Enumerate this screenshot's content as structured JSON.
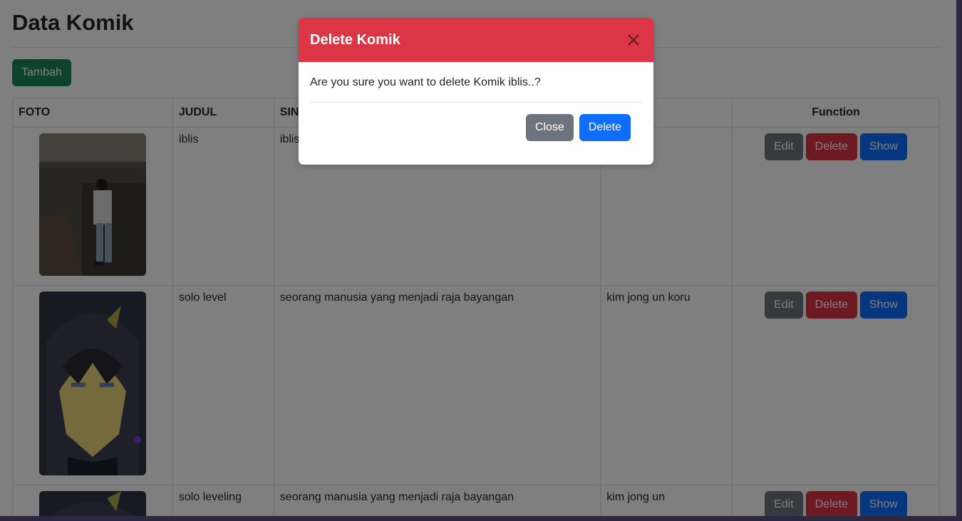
{
  "page": {
    "title": "Data Komik",
    "add_button": "Tambah"
  },
  "table": {
    "headers": {
      "foto": "FOTO",
      "judul": "JUDUL",
      "sinopsis": "SIN",
      "penulis": "",
      "function": "Function"
    },
    "rows": [
      {
        "judul": "iblis",
        "sinopsis": "iblis",
        "penulis": "",
        "foto_icon": "photo-person-wall"
      },
      {
        "judul": "solo level",
        "sinopsis": "seorang manusia yang menjadi raja bayangan",
        "penulis": "kim jong un koru",
        "foto_icon": "photo-anime-character"
      },
      {
        "judul": "solo leveling",
        "sinopsis": "seorang manusia yang menjadi raja bayangan",
        "penulis": "kim jong un",
        "foto_icon": "photo-anime-character"
      }
    ],
    "actions": {
      "edit": "Edit",
      "delete": "Delete",
      "show": "Show"
    }
  },
  "modal": {
    "title": "Delete Komik",
    "message": "Are you sure you want to delete Komik iblis..?",
    "close_button": "Close",
    "delete_button": "Delete"
  },
  "colors": {
    "success": "#198754",
    "secondary": "#6c757d",
    "danger": "#dc3545",
    "primary": "#0d6efd"
  }
}
